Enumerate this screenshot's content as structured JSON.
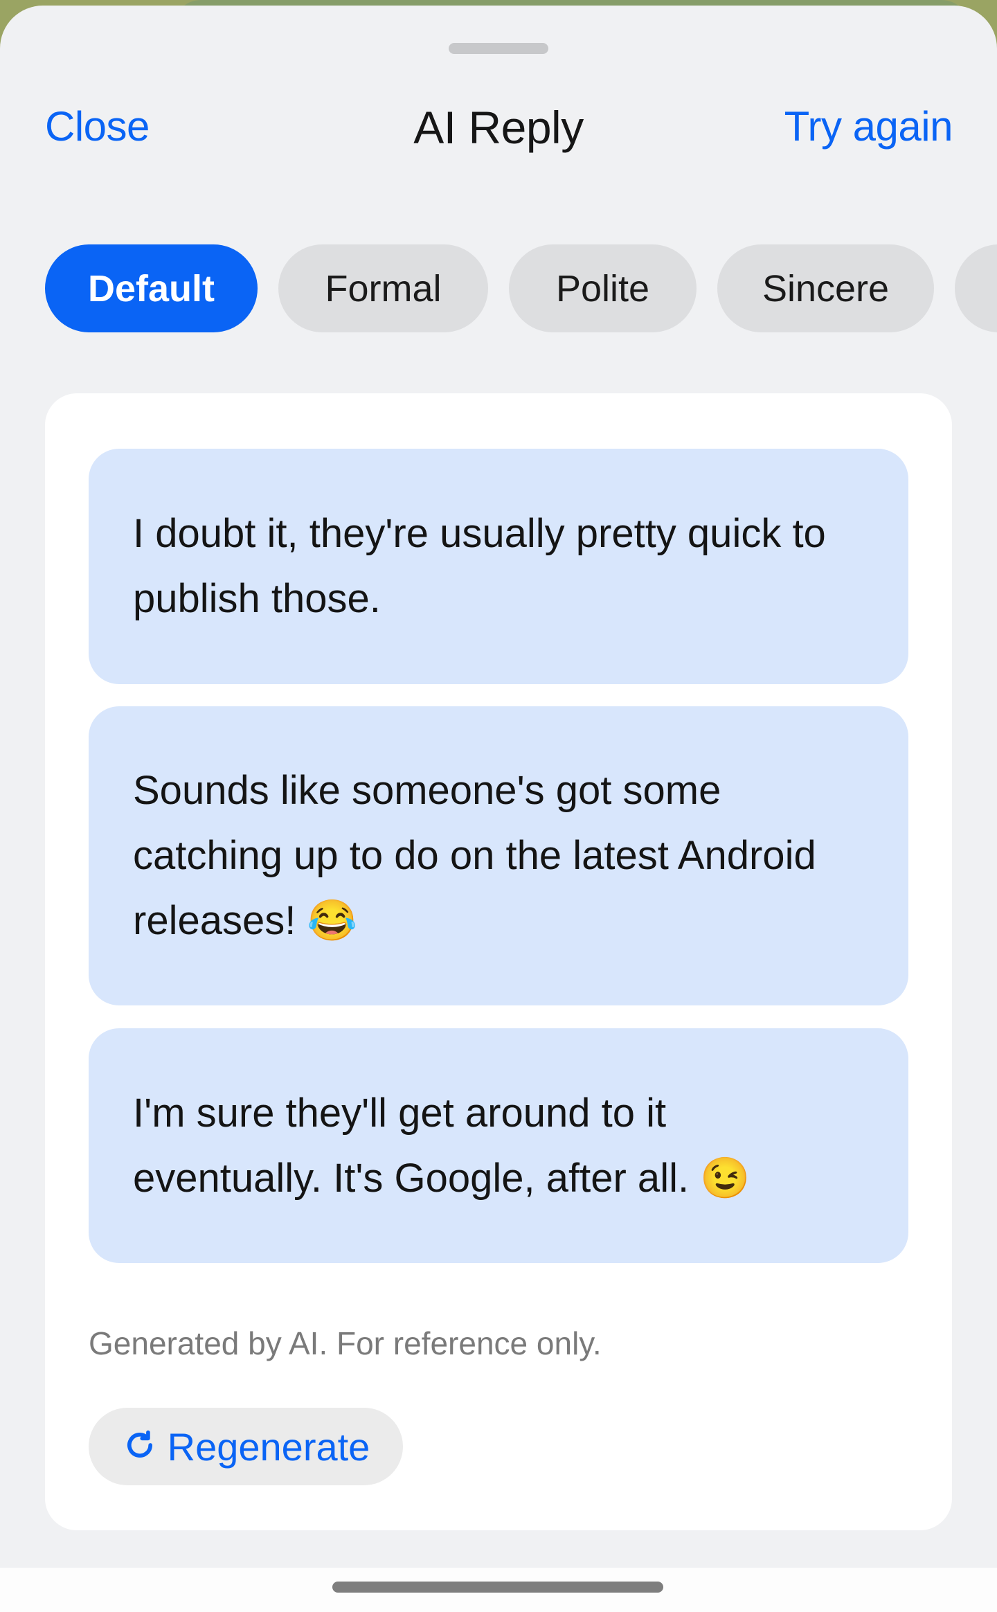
{
  "header": {
    "close_label": "Close",
    "title": "AI Reply",
    "try_again_label": "Try again"
  },
  "tone_tabs": [
    {
      "label": "Default",
      "selected": true
    },
    {
      "label": "Formal",
      "selected": false
    },
    {
      "label": "Polite",
      "selected": false
    },
    {
      "label": "Sincere",
      "selected": false
    },
    {
      "label": "",
      "selected": false
    }
  ],
  "suggestions": [
    {
      "text": "I doubt it, they're usually pretty quick to publish those."
    },
    {
      "text": "Sounds like someone's got some catching up to do on the latest Android releases! 😂"
    },
    {
      "text": "I'm sure they'll get around to it eventually. It's Google, after all. 😉"
    }
  ],
  "disclaimer": "Generated by AI. For reference only.",
  "regenerate": {
    "label": "Regenerate",
    "icon": "refresh-icon"
  },
  "colors": {
    "accent": "#0a64f5",
    "bubble": "#d8e6fc",
    "sheet": "#f0f1f3",
    "chip": "#dddee0"
  }
}
